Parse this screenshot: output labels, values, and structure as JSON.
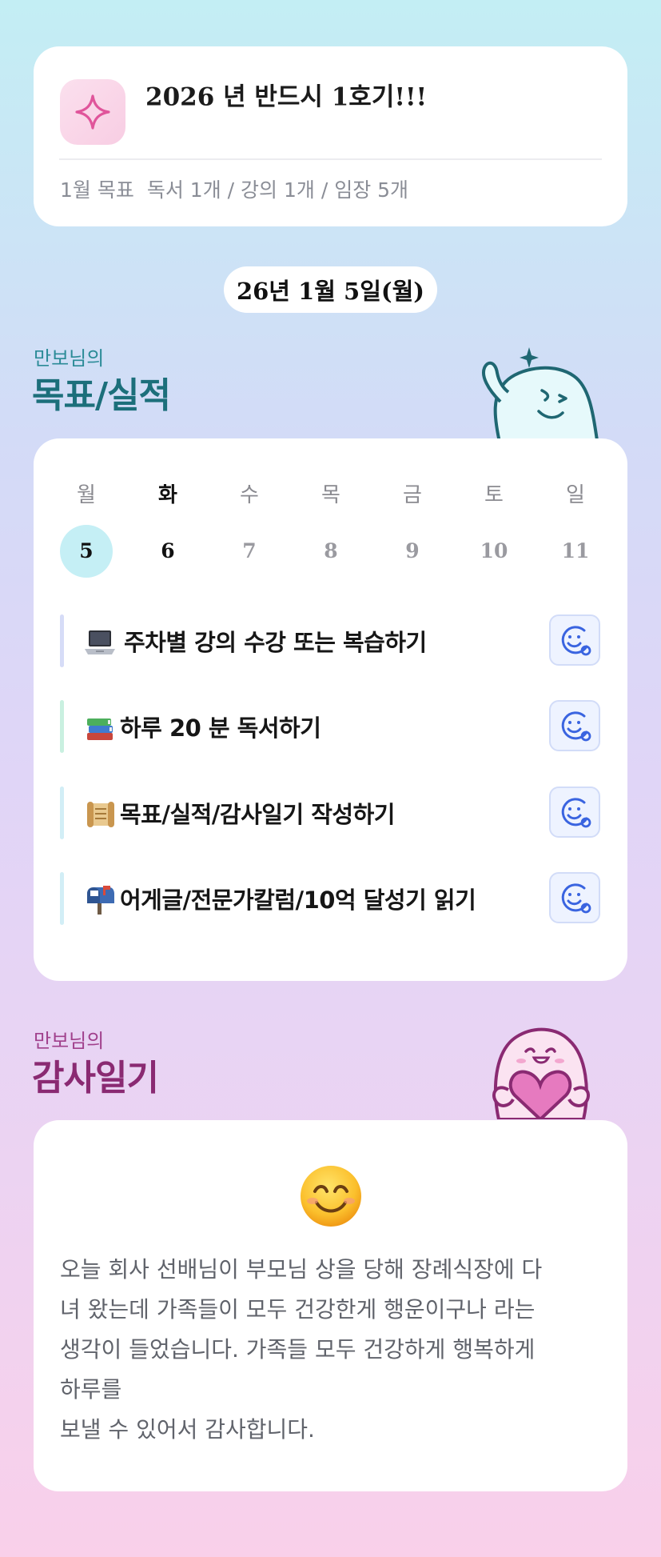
{
  "challenge": {
    "title": "2026 년 반드시 1호기!!!",
    "goal_label": "1월 목표",
    "goal_text": "독서 1개 / 강의 1개 / 임장 5개",
    "icon": "sparkle-icon"
  },
  "date_pill": "26년 1월 5일(월)",
  "goals_section": {
    "subtitle": "만보님의",
    "title": "목표/실적",
    "mascot": "waving-ghost-mascot"
  },
  "week": {
    "days": [
      "월",
      "화",
      "수",
      "목",
      "금",
      "토",
      "일"
    ],
    "dates": [
      "5",
      "6",
      "7",
      "8",
      "9",
      "10",
      "11"
    ],
    "selected_index": 0,
    "today_index": 1
  },
  "tasks": [
    {
      "emoji": "laptop-icon",
      "label": "주차별 강의 수강 또는 복습하기",
      "bar_color": "#d6dcf7"
    },
    {
      "emoji": "books-icon",
      "label": "하루 20 분 독서하기",
      "bar_color": "#c9f0e0"
    },
    {
      "emoji": "scroll-icon",
      "label": "목표/실적/감사일기 작성하기",
      "bar_color": "#d2eef6"
    },
    {
      "emoji": "mailbox-icon",
      "label": "어게글/전문가칼럼/10억 달성기 읽기",
      "bar_color": "#d2eef6"
    }
  ],
  "gratitude_section": {
    "subtitle": "만보님의",
    "title": "감사일기",
    "mascot": "heart-ghost-mascot",
    "mood_icon": "smiling-face-icon",
    "lines": [
      "오늘 회사 선배님이 부모님 상을 당해 장례식장에 다",
      "녀 왔는데 가족들이 모두 건강한게 행운이구나 라는",
      "생각이 들었습니다. 가족들 모두 건강하게 행복하게",
      "하루를",
      "보낼 수 있어서 감사합니다."
    ]
  },
  "colors": {
    "goal_title": "#1c6f7b",
    "gratitude_title": "#8a2a72",
    "selected_date_bg": "#c5eff5",
    "task_button_bg": "#eef3ff",
    "task_button_icon": "#3a64e0"
  }
}
